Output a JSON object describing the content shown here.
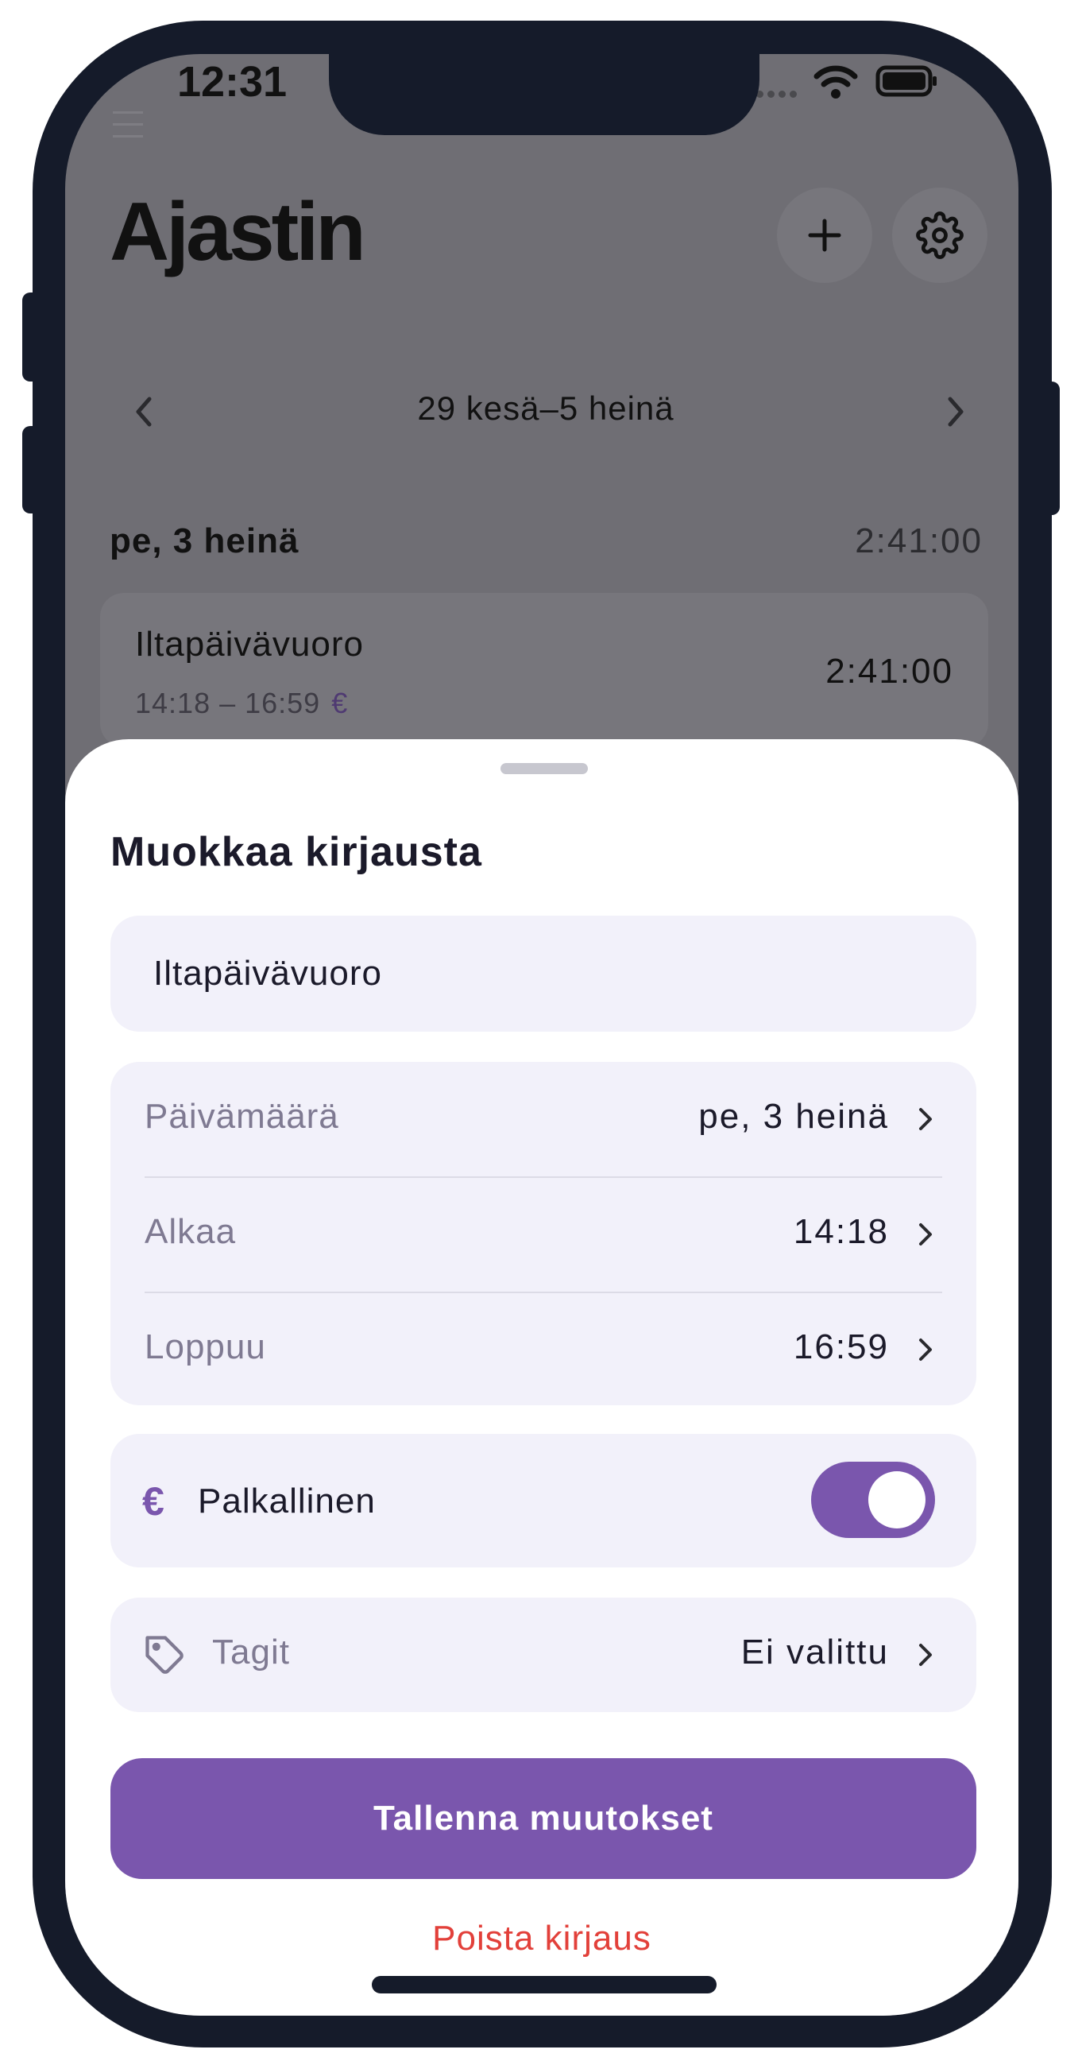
{
  "status_bar": {
    "time": "12:31"
  },
  "header": {
    "title": "Ajastin",
    "add_icon": "plus-icon",
    "settings_icon": "gear-icon"
  },
  "week_nav": {
    "label": "29 kesä–5 heinä"
  },
  "day": {
    "date": "pe, 3 heinä",
    "total": "2:41:00",
    "entries": [
      {
        "name": "Iltapäivävuoro",
        "time_range": "14:18 – 16:59",
        "paid_symbol": "€",
        "duration": "2:41:00"
      }
    ]
  },
  "sheet": {
    "title": "Muokkaa kirjausta",
    "name_input": {
      "value": "Iltapäivävuoro"
    },
    "rows": [
      {
        "label": "Päivämäärä",
        "value": "pe, 3 heinä"
      },
      {
        "label": "Alkaa",
        "value": "14:18"
      },
      {
        "label": "Loppuu",
        "value": "16:59"
      }
    ],
    "paid": {
      "symbol": "€",
      "label": "Palkallinen",
      "enabled": true
    },
    "tags": {
      "label": "Tagit",
      "value": "Ei valittu",
      "icon": "tag-icon"
    },
    "save_label": "Tallenna muutokset",
    "delete_label": "Poista kirjaus"
  },
  "colors": {
    "accent": "#7a56ad",
    "danger": "#e2403a",
    "field_background": "#f2f1fa",
    "frame": "#151b2a"
  }
}
